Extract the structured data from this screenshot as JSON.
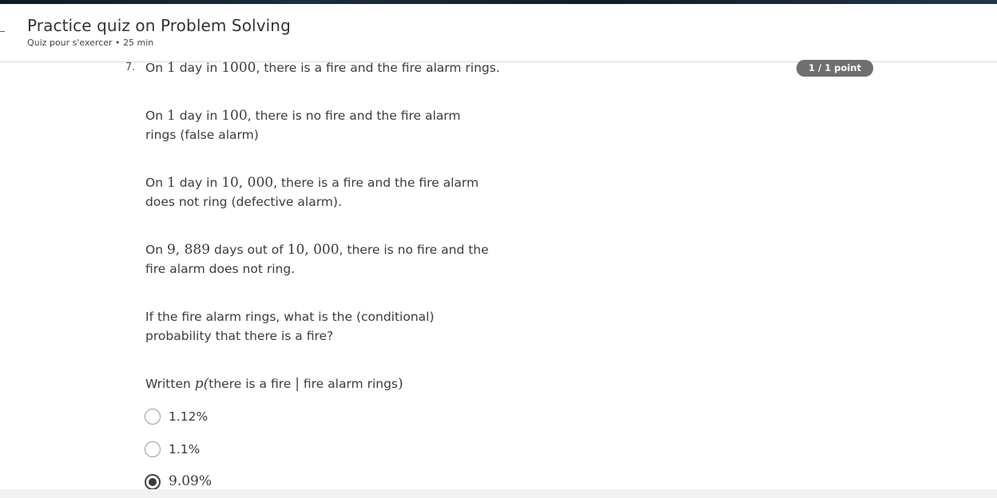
{
  "header": {
    "title": "Practice quiz on Problem Solving",
    "subtitle": "Quiz pour s'exercer • 25 min"
  },
  "question": {
    "number": "7.",
    "points": "1 / 1 point",
    "p1": {
      "a": "On ",
      "m1": "1",
      "b": " day in ",
      "m2": "1000",
      "c": ", there is a fire and the fire alarm rings."
    },
    "p2": {
      "a": "On ",
      "m1": "1",
      "b": " day in ",
      "m2": "100",
      "c": ", there is no fire and the fire alarm rings (false alarm)"
    },
    "p3": {
      "a": "On ",
      "m1": "1",
      "b": " day in ",
      "m2": "10, 000",
      "c": ", there is a fire and the fire alarm does not ring (defective alarm)."
    },
    "p4": {
      "a": "On ",
      "m1": "9, 889",
      "b": " days out of ",
      "m2": "10, 000",
      "c": ", there is no fire and the fire alarm does not ring."
    },
    "p5": "If the fire alarm rings, what is the (conditional) probability that there is a fire?",
    "p6": {
      "a": "Written ",
      "m1": "p(",
      "b": "there is a fire ",
      "m2": "|",
      "c": " fire alarm rings",
      "m3": ")"
    },
    "options": [
      {
        "label": "1.12%",
        "selected": false
      },
      {
        "label": "1.1%",
        "selected": false
      },
      {
        "label": "9.09%",
        "selected": true
      }
    ]
  }
}
